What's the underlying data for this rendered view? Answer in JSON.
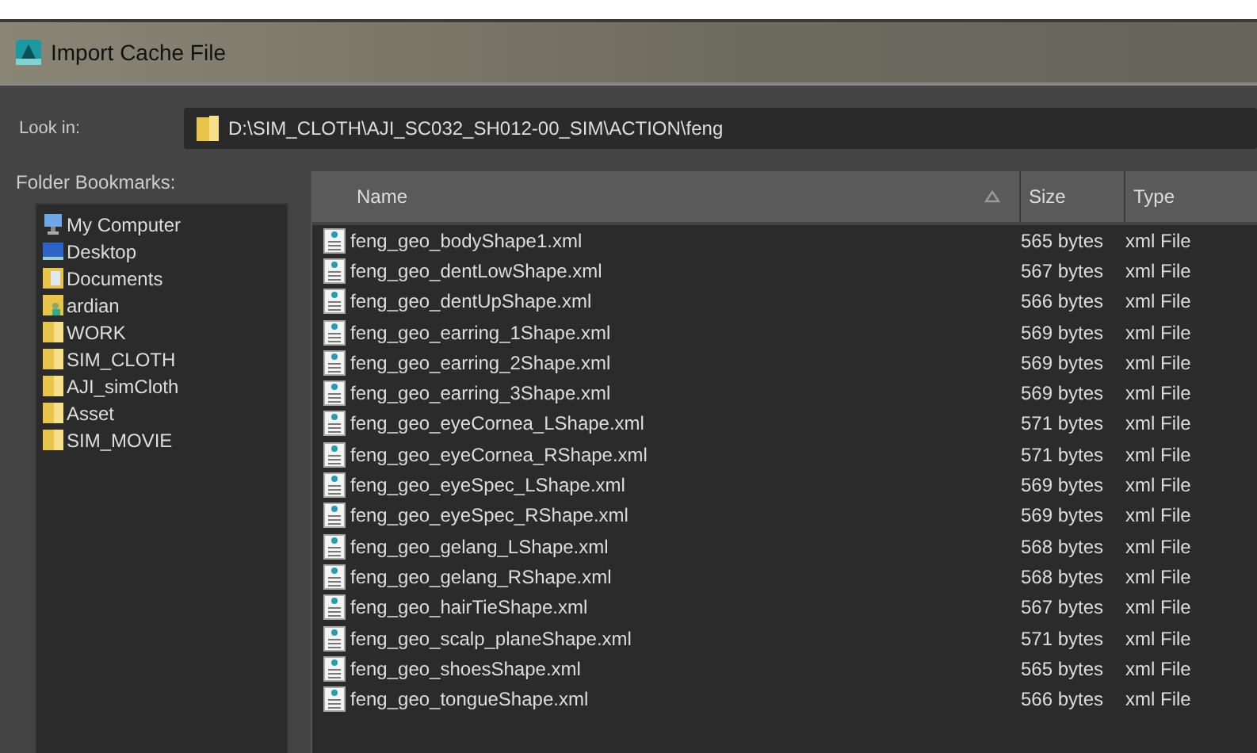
{
  "window": {
    "title": "Import Cache File"
  },
  "look_in": {
    "label": "Look in:",
    "path": "D:\\SIM_CLOTH\\AJI_SC032_SH012-00_SIM\\ACTION\\feng"
  },
  "bookmarks": {
    "label": "Folder Bookmarks:",
    "items": [
      {
        "label": "My Computer",
        "kind": "computer"
      },
      {
        "label": "Desktop",
        "kind": "desktop"
      },
      {
        "label": "Documents",
        "kind": "documents"
      },
      {
        "label": "ardian",
        "kind": "user"
      },
      {
        "label": "WORK",
        "kind": "folder"
      },
      {
        "label": "SIM_CLOTH",
        "kind": "folder"
      },
      {
        "label": "AJI_simCloth",
        "kind": "folder"
      },
      {
        "label": "Asset",
        "kind": "folder"
      },
      {
        "label": "SIM_MOVIE",
        "kind": "folder"
      }
    ]
  },
  "table": {
    "columns": [
      "Name",
      "Size",
      "Type"
    ],
    "rows": [
      {
        "name": "feng_geo_bodyShape1.xml",
        "size": "565 bytes",
        "type": "xml File"
      },
      {
        "name": "feng_geo_dentLowShape.xml",
        "size": "567 bytes",
        "type": "xml File"
      },
      {
        "name": "feng_geo_dentUpShape.xml",
        "size": "566 bytes",
        "type": "xml File"
      },
      {
        "name": "feng_geo_earring_1Shape.xml",
        "size": "569 bytes",
        "type": "xml File"
      },
      {
        "name": "feng_geo_earring_2Shape.xml",
        "size": "569 bytes",
        "type": "xml File"
      },
      {
        "name": "feng_geo_earring_3Shape.xml",
        "size": "569 bytes",
        "type": "xml File"
      },
      {
        "name": "feng_geo_eyeCornea_LShape.xml",
        "size": "571 bytes",
        "type": "xml File"
      },
      {
        "name": "feng_geo_eyeCornea_RShape.xml",
        "size": "571 bytes",
        "type": "xml File"
      },
      {
        "name": "feng_geo_eyeSpec_LShape.xml",
        "size": "569 bytes",
        "type": "xml File"
      },
      {
        "name": "feng_geo_eyeSpec_RShape.xml",
        "size": "569 bytes",
        "type": "xml File"
      },
      {
        "name": "feng_geo_gelang_LShape.xml",
        "size": "568 bytes",
        "type": "xml File"
      },
      {
        "name": "feng_geo_gelang_RShape.xml",
        "size": "568 bytes",
        "type": "xml File"
      },
      {
        "name": "feng_geo_hairTieShape.xml",
        "size": "567 bytes",
        "type": "xml File"
      },
      {
        "name": "feng_geo_scalp_planeShape.xml",
        "size": "571 bytes",
        "type": "xml File"
      },
      {
        "name": "feng_geo_shoesShape.xml",
        "size": "565 bytes",
        "type": "xml File"
      },
      {
        "name": "feng_geo_tongueShape.xml",
        "size": "566 bytes",
        "type": "xml File"
      }
    ]
  }
}
